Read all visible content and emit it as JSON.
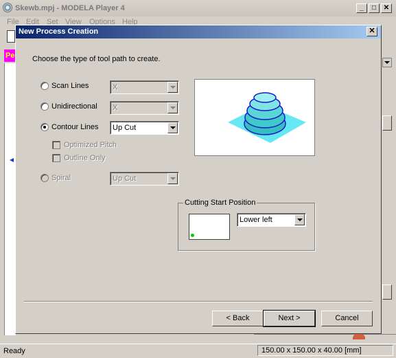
{
  "app": {
    "title": "Skewb.mpj - MODELA Player 4",
    "menu": [
      "File",
      "Edit",
      "Set",
      "View",
      "Options",
      "Help"
    ],
    "status_left": "Ready",
    "status_right": "150.00 x 150.00 x 40.00 [mm]"
  },
  "dialog": {
    "title": "New Process Creation",
    "close_label": "✕",
    "prompt": "Choose the type of tool path to create.",
    "options": {
      "scan_lines": "Scan Lines",
      "unidirectional": "Unidirectional",
      "contour_lines": "Contour Lines",
      "optimized_pitch": "Optimized Pitch",
      "outline_only": "Outline Only",
      "spiral": "Spiral"
    },
    "selected_option": "contour_lines",
    "combos": {
      "scan_lines": "X",
      "unidirectional": "X",
      "contour_lines": "Up Cut",
      "spiral": "Up Cut"
    },
    "cutting_start": {
      "label": "Cutting Start Position",
      "value": "Lower left"
    },
    "buttons": {
      "back": "< Back",
      "next": "Next >",
      "cancel": "Cancel"
    }
  },
  "colors": {
    "title_gradient_start": "#0a246a",
    "title_gradient_end": "#a6caf0",
    "preview_plane": "#66e8f4",
    "preview_contour": "#1a1acc",
    "start_dot": "#00cc00"
  }
}
